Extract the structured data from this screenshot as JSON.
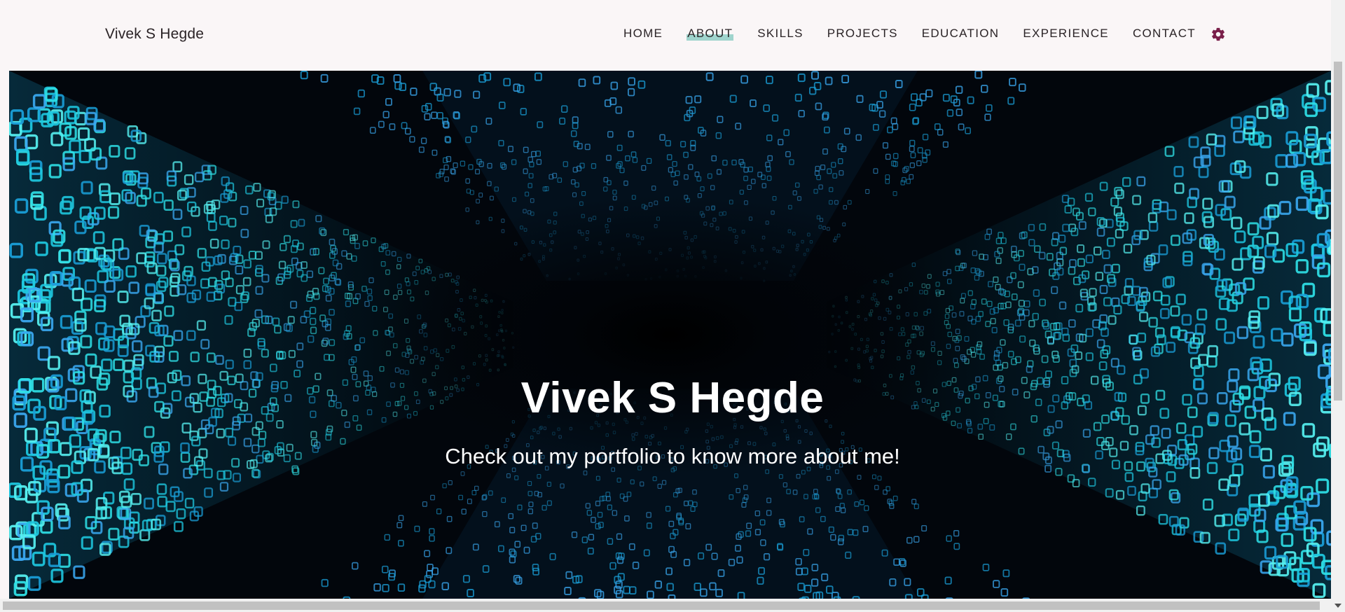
{
  "navbar": {
    "brand": "Vivek S Hegde",
    "links": [
      {
        "label": "HOME",
        "active": false
      },
      {
        "label": "ABOUT",
        "active": true
      },
      {
        "label": "SKILLS",
        "active": false
      },
      {
        "label": "PROJECTS",
        "active": false
      },
      {
        "label": "EDUCATION",
        "active": false
      },
      {
        "label": "EXPERIENCE",
        "active": false
      },
      {
        "label": "CONTACT",
        "active": false
      }
    ],
    "settings_icon": "gear-icon",
    "settings_icon_color": "#7a1f4a",
    "active_highlight_color": "#9fd4cd"
  },
  "hero": {
    "title": "Vivek S Hegde",
    "subtitle": "Check out my portfolio to know more about me!",
    "background_colors": [
      "#02060c",
      "#1aa7d6",
      "#3fe6ea"
    ]
  }
}
